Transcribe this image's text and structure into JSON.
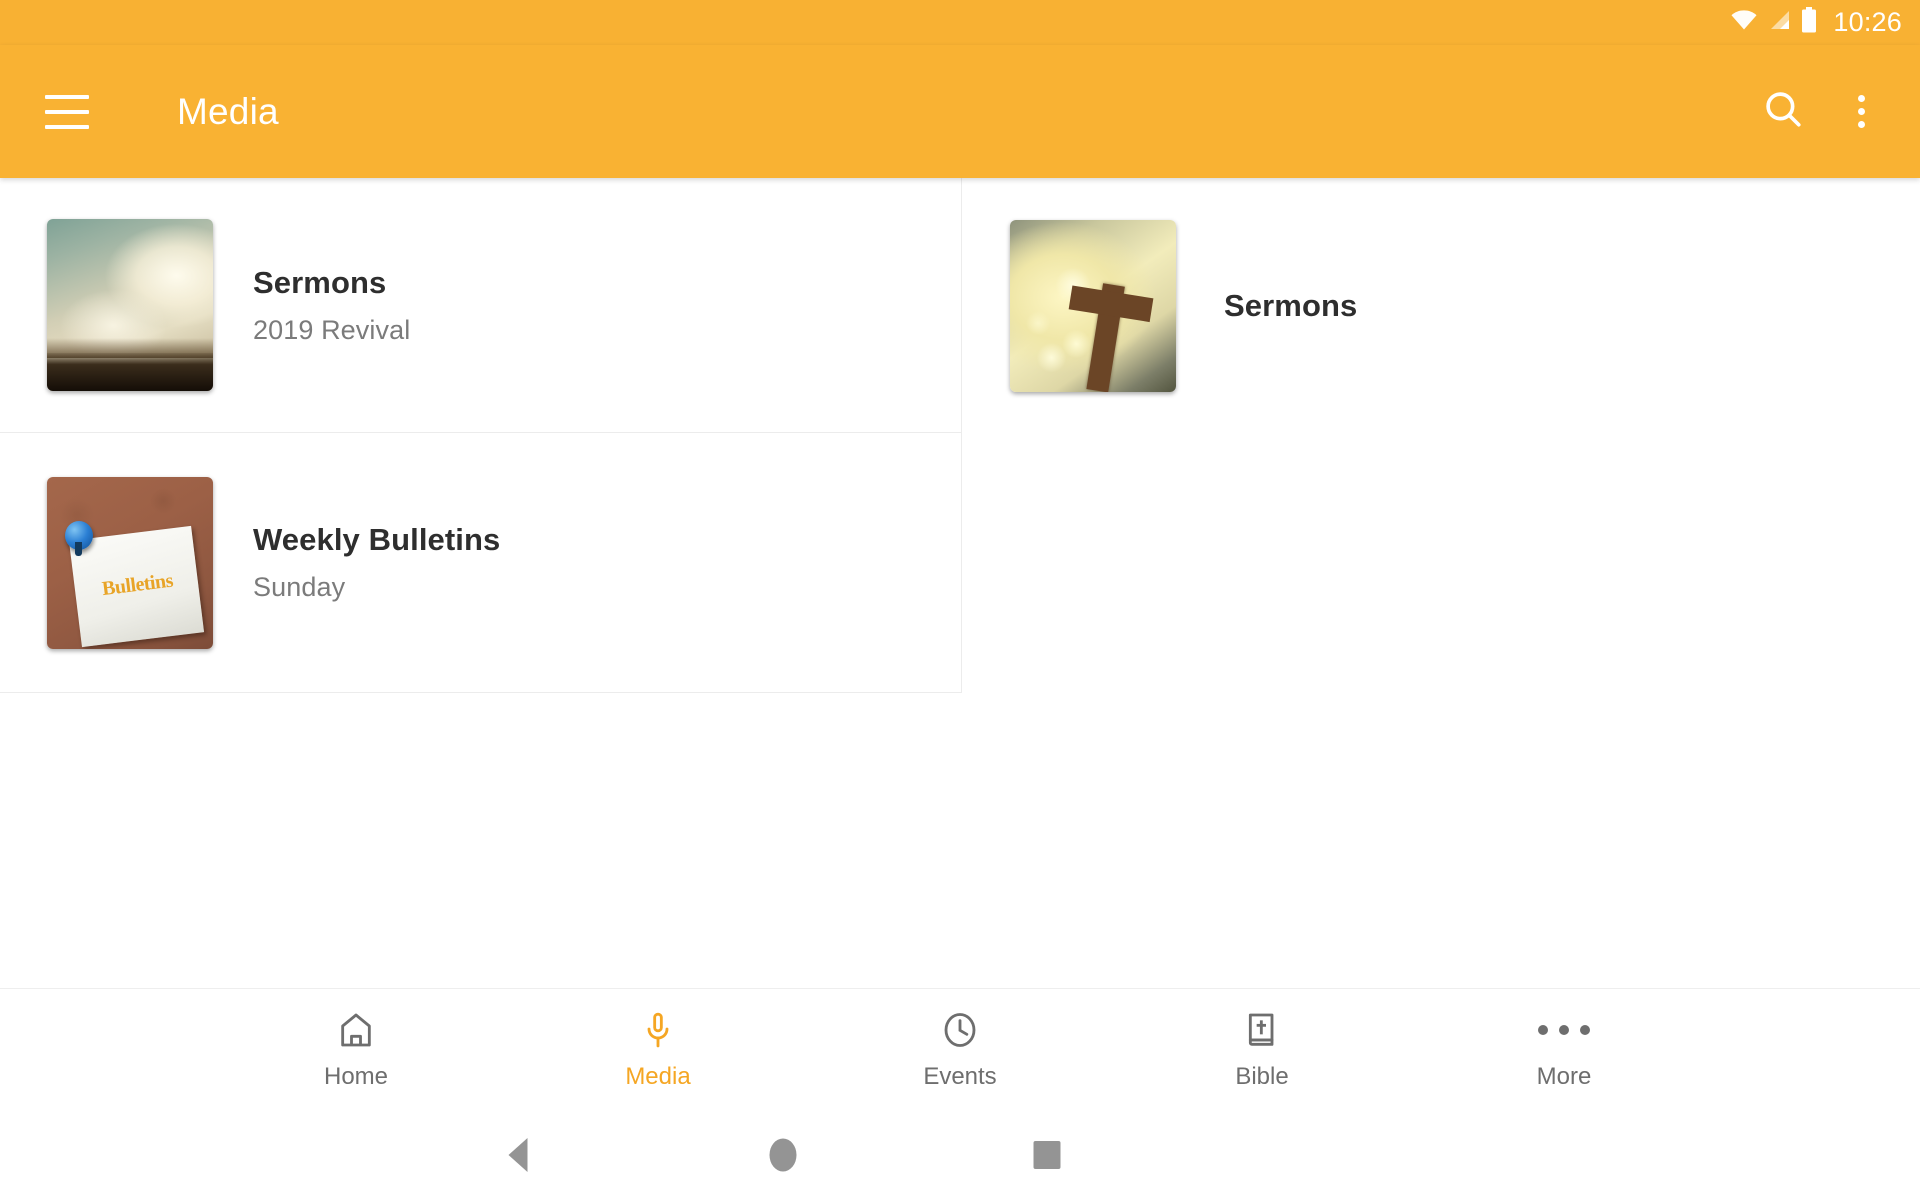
{
  "status_bar": {
    "time": "10:26",
    "icons": [
      "wifi-icon",
      "cell-signal-icon",
      "battery-icon"
    ]
  },
  "app_bar": {
    "title": "Media",
    "menu_icon": "hamburger-menu-icon",
    "search_icon": "search-icon",
    "overflow_icon": "more-vertical-icon",
    "background_color": "#F9B233"
  },
  "cards": [
    {
      "title": "Sermons",
      "subtitle": "2019 Revival",
      "thumbnail": "clouds-sunbeam-image",
      "column": "left"
    },
    {
      "title": "Sermons",
      "subtitle": "",
      "thumbnail": "cross-bokeh-image",
      "column": "right"
    },
    {
      "title": "Weekly Bulletins",
      "subtitle": "Sunday",
      "thumbnail": "corkboard-bulletin-image",
      "thumbnail_text": "Bulletins",
      "column": "left"
    }
  ],
  "bottom_tabs": {
    "active": "Media",
    "active_color": "#F5A623",
    "inactive_color": "#6E6E6E",
    "items": [
      {
        "label": "Home",
        "icon": "home-icon"
      },
      {
        "label": "Media",
        "icon": "microphone-icon"
      },
      {
        "label": "Events",
        "icon": "clock-icon"
      },
      {
        "label": "Bible",
        "icon": "bible-book-icon"
      },
      {
        "label": "More",
        "icon": "more-horizontal-icon"
      }
    ]
  },
  "system_nav": {
    "back": "back-triangle-icon",
    "home": "home-circle-icon",
    "recents": "recents-square-icon"
  }
}
